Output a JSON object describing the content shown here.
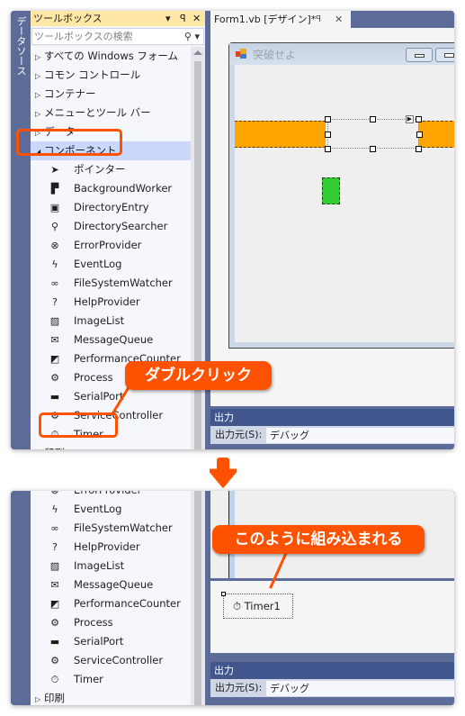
{
  "side_tab": {
    "label": "データソース"
  },
  "toolbox": {
    "title": "ツールボックス",
    "controls": {
      "dropdown": "▾",
      "pin": "ꟼ",
      "close": "✕"
    },
    "search_placeholder": "ツールボックスの検索",
    "categories_before": [
      {
        "label": "すべての Windows フォーム"
      },
      {
        "label": "コモン コントロール"
      },
      {
        "label": "コンテナー"
      },
      {
        "label": "メニューとツール バー"
      },
      {
        "label": "データ"
      }
    ],
    "expanded_category": {
      "label": "コンポーネント"
    },
    "items": [
      {
        "label": "ポインター",
        "icon": "pointer-icon",
        "glyph": "➤"
      },
      {
        "label": "BackgroundWorker",
        "icon": "background-worker-icon",
        "glyph": "▛"
      },
      {
        "label": "DirectoryEntry",
        "icon": "directory-entry-icon",
        "glyph": "▣"
      },
      {
        "label": "DirectorySearcher",
        "icon": "directory-searcher-icon",
        "glyph": "⚲"
      },
      {
        "label": "ErrorProvider",
        "icon": "error-provider-icon",
        "glyph": "⊗"
      },
      {
        "label": "EventLog",
        "icon": "event-log-icon",
        "glyph": "ϟ"
      },
      {
        "label": "FileSystemWatcher",
        "icon": "file-system-watcher-icon",
        "glyph": "∞"
      },
      {
        "label": "HelpProvider",
        "icon": "help-provider-icon",
        "glyph": "?"
      },
      {
        "label": "ImageList",
        "icon": "image-list-icon",
        "glyph": "▨"
      },
      {
        "label": "MessageQueue",
        "icon": "message-queue-icon",
        "glyph": "✉"
      },
      {
        "label": "PerformanceCounter",
        "icon": "performance-counter-icon",
        "glyph": "◩"
      },
      {
        "label": "Process",
        "icon": "process-icon",
        "glyph": "⚙"
      },
      {
        "label": "SerialPort",
        "icon": "serial-port-icon",
        "glyph": "▬"
      },
      {
        "label": "ServiceController",
        "icon": "service-controller-icon",
        "glyph": "⚙"
      },
      {
        "label": "Timer",
        "icon": "timer-icon",
        "glyph": "⏱"
      }
    ],
    "category_after": {
      "label": "印刷"
    }
  },
  "editor": {
    "tab_label": "Form1.vb [デザイン]*",
    "tab_pin": "ꟼ",
    "tab_close": "✕",
    "form_title": "突破せよ"
  },
  "output": {
    "title": "出力",
    "source_label": "出力元(S):",
    "source_value": "デバッグ"
  },
  "annotations": {
    "double_click": "ダブルクリック",
    "embedded": "このように組み込まれる"
  },
  "bottom": {
    "partial_item": "ErrorProvider",
    "items": [
      {
        "label": "EventLog",
        "icon": "event-log-icon",
        "glyph": "ϟ"
      },
      {
        "label": "FileSystemWatcher",
        "icon": "file-system-watcher-icon",
        "glyph": "∞"
      },
      {
        "label": "HelpProvider",
        "icon": "help-provider-icon",
        "glyph": "?"
      },
      {
        "label": "ImageList",
        "icon": "image-list-icon",
        "glyph": "▨"
      },
      {
        "label": "MessageQueue",
        "icon": "message-queue-icon",
        "glyph": "✉"
      },
      {
        "label": "PerformanceCounter",
        "icon": "performance-counter-icon",
        "glyph": "◩"
      },
      {
        "label": "Process",
        "icon": "process-icon",
        "glyph": "⚙"
      },
      {
        "label": "SerialPort",
        "icon": "serial-port-icon",
        "glyph": "▬"
      },
      {
        "label": "ServiceController",
        "icon": "service-controller-icon",
        "glyph": "⚙"
      },
      {
        "label": "Timer",
        "icon": "timer-icon",
        "glyph": "⏱"
      }
    ],
    "category_after": {
      "label": "印刷"
    },
    "tray_component": "Timer1"
  },
  "colors": {
    "accent_callout": "#ff5200",
    "vs_frame": "#5d6b99",
    "toolbox_header": "#ffe8a6",
    "selected_row": "#c9d8fc",
    "orange_control": "#ffa500",
    "green_control": "#33cc33"
  }
}
